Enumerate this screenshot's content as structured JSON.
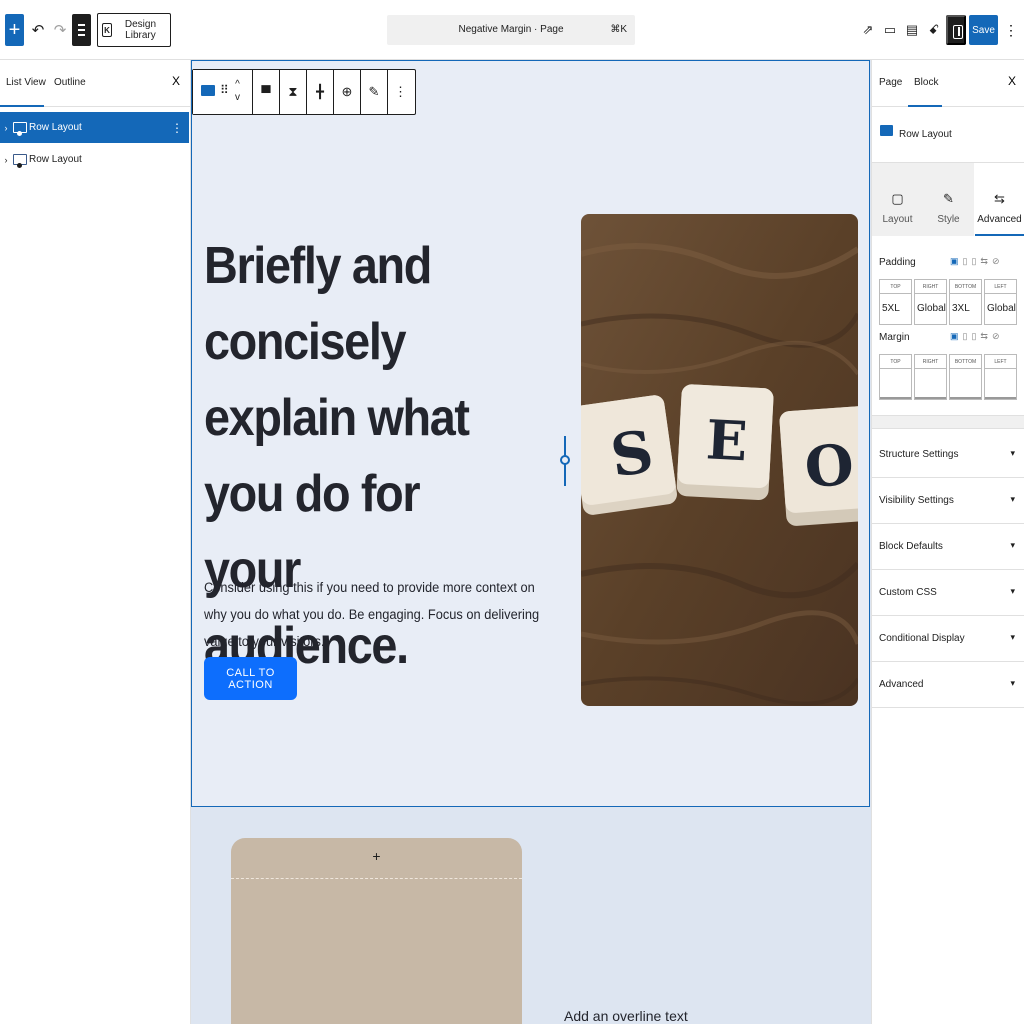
{
  "topbar": {
    "add_icon": "plus-icon",
    "design_library_label": "Design Library",
    "command_title": "Negative Margin · Page",
    "command_shortcut": "⌘K",
    "save_label": "Save",
    "accent_color": "#1468b8"
  },
  "listview": {
    "tabs": [
      {
        "label": "List View"
      },
      {
        "label": "Outline"
      }
    ],
    "close_label": "X",
    "items": [
      {
        "label": "Row Layout",
        "selected": true
      },
      {
        "label": "Row Layout",
        "selected": false
      }
    ]
  },
  "canvas": {
    "headline": "Briefly and concisely explain what you do for your audience.",
    "subtext": "Consider using this if you need to provide more context on why you do what you do. Be engaging. Focus on delivering value to your visitors.",
    "cta_label": "CALL TO ACTION",
    "overline": "Add an overline text",
    "row2_plus": "+",
    "cta_color": "#0d6efd"
  },
  "sidebar": {
    "tabs": [
      {
        "label": "Page"
      },
      {
        "label": "Block"
      }
    ],
    "close_label": "X",
    "block_name": "Row Layout",
    "panel_tabs": [
      {
        "label": "Layout"
      },
      {
        "label": "Style"
      },
      {
        "label": "Advanced"
      }
    ],
    "padding": {
      "label": "Padding",
      "sides": [
        "TOP",
        "RIGHT",
        "BOTTOM",
        "LEFT"
      ],
      "values": [
        "5XL",
        "Global",
        "3XL",
        "Global"
      ]
    },
    "margin": {
      "label": "Margin",
      "sides": [
        "TOP",
        "RIGHT",
        "BOTTOM",
        "LEFT"
      ],
      "values": [
        "",
        "",
        "",
        ""
      ]
    },
    "accordions": [
      {
        "label": "Structure Settings"
      },
      {
        "label": "Visibility Settings"
      },
      {
        "label": "Block Defaults"
      },
      {
        "label": "Custom CSS"
      },
      {
        "label": "Conditional Display"
      },
      {
        "label": "Advanced"
      }
    ]
  }
}
